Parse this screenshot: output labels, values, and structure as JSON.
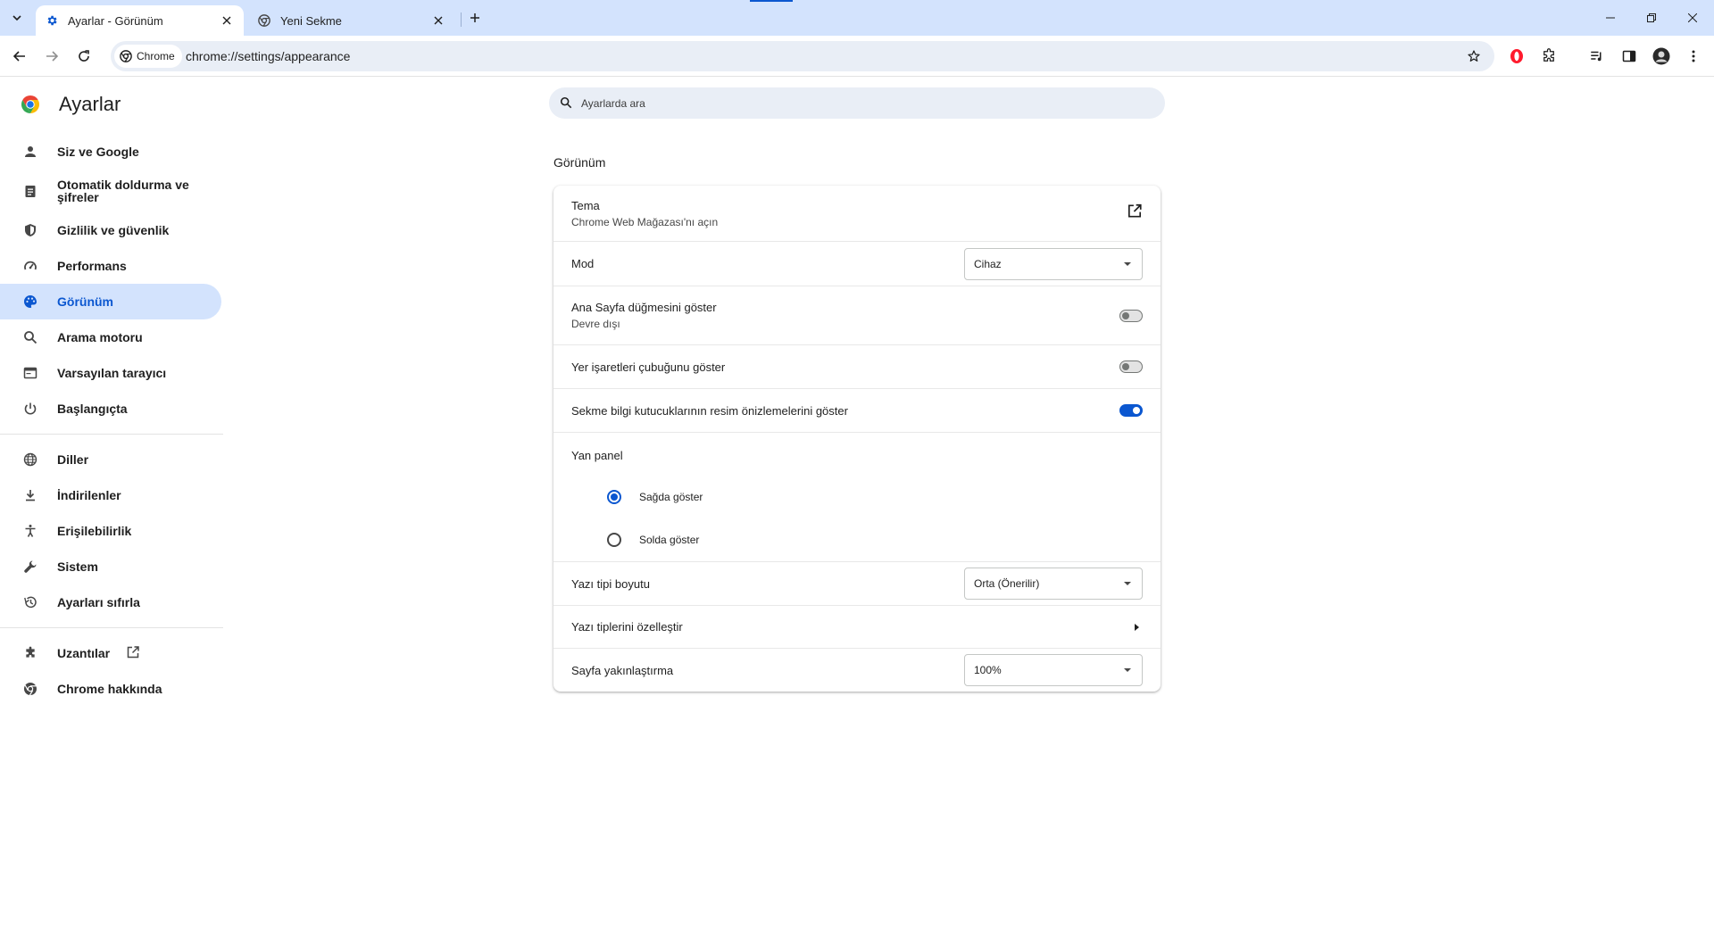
{
  "browser": {
    "tabs": [
      {
        "title": "Ayarlar - Görünüm",
        "active": true
      },
      {
        "title": "Yeni Sekme",
        "active": false
      }
    ],
    "omnibox": {
      "chip_label": "Chrome",
      "url": "chrome://settings/appearance"
    }
  },
  "settings": {
    "title": "Ayarlar",
    "search_placeholder": "Ayarlarda ara",
    "nav": [
      {
        "label": "Siz ve Google",
        "icon": "person-icon"
      },
      {
        "label": "Otomatik doldurma ve şifreler",
        "icon": "clipboard-icon"
      },
      {
        "label": "Gizlilik ve güvenlik",
        "icon": "shield-icon"
      },
      {
        "label": "Performans",
        "icon": "speedometer-icon"
      },
      {
        "label": "Görünüm",
        "icon": "palette-icon",
        "selected": true
      },
      {
        "label": "Arama motoru",
        "icon": "search-icon"
      },
      {
        "label": "Varsayılan tarayıcı",
        "icon": "browser-window-icon"
      },
      {
        "label": "Başlangıçta",
        "icon": "power-icon"
      },
      {
        "label": "Diller",
        "icon": "globe-icon"
      },
      {
        "label": "İndirilenler",
        "icon": "download-icon"
      },
      {
        "label": "Erişilebilirlik",
        "icon": "accessibility-icon"
      },
      {
        "label": "Sistem",
        "icon": "wrench-icon"
      },
      {
        "label": "Ayarları sıfırla",
        "icon": "history-icon"
      },
      {
        "label": "Uzantılar",
        "icon": "puzzle-icon"
      },
      {
        "label": "Chrome hakkında",
        "icon": "chrome-icon"
      }
    ],
    "section_title": "Görünüm",
    "rows": {
      "theme_label": "Tema",
      "theme_sub": "Chrome Web Mağazası'nı açın",
      "mode_label": "Mod",
      "mode_value": "Cihaz",
      "home_label": "Ana Sayfa düğmesini göster",
      "home_sub": "Devre dışı",
      "home_enabled": false,
      "bookmarks_label": "Yer işaretleri çubuğunu göster",
      "bookmarks_enabled": false,
      "hover_label": "Sekme bilgi kutucuklarının resim önizlemelerini göster",
      "hover_enabled": true,
      "side_panel_label": "Yan panel",
      "side_right": "Sağda göster",
      "side_left": "Solda göster",
      "side_selected": "right",
      "font_size_label": "Yazı tipi boyutu",
      "font_size_value": "Orta (Önerilir)",
      "customize_fonts_label": "Yazı tiplerini özelleştir",
      "zoom_label": "Sayfa yakınlaştırma",
      "zoom_value": "100%"
    }
  },
  "colors": {
    "accent": "#0b57d0",
    "selected_bg": "#d3e3fd",
    "tabstrip_bg": "#d3e3fd",
    "omnibox_bg": "#e9eef6"
  }
}
